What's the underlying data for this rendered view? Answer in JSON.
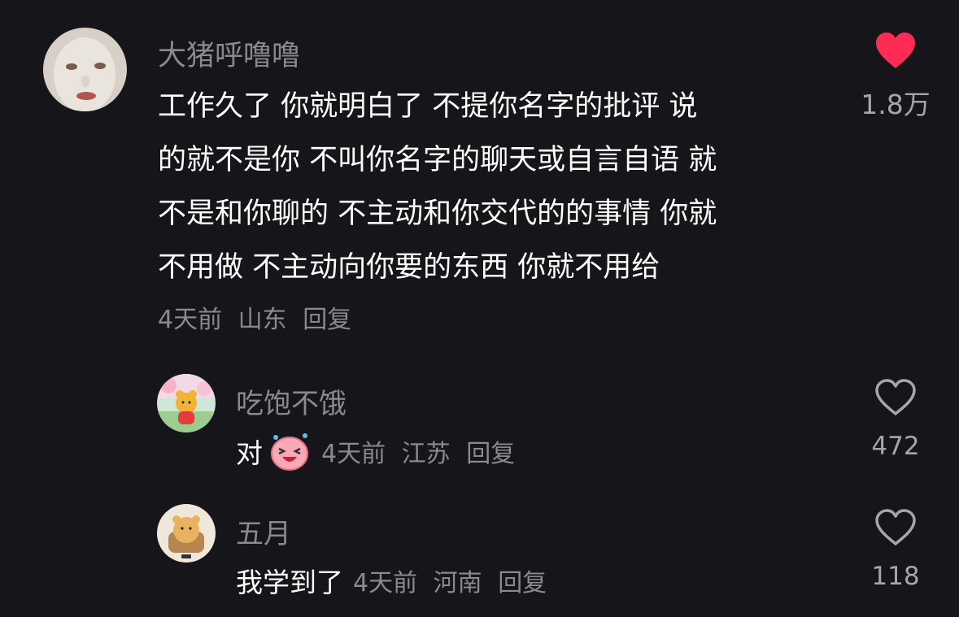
{
  "comments": [
    {
      "username": "大猪呼噜噜",
      "content_lines": [
        "工作久了 你就明白了 不提你名字的批评 说",
        "的就不是你 不叫你名字的聊天或自言自语 就",
        "不是和你聊的 不主动和你交代的的事情 你就",
        "不用做 不主动向你要的东西 你就不用给"
      ],
      "time": "4天前",
      "location": "山东",
      "reply_label": "回复",
      "likes": "1.8万",
      "liked": true,
      "like_icon": "heart-filled-icon",
      "like_color": "#fe2c55"
    }
  ],
  "replies": [
    {
      "username": "吃饱不饿",
      "text": "对",
      "sticker": "laughing-sticker-icon",
      "time": "4天前",
      "location": "江苏",
      "reply_label": "回复",
      "likes": "472",
      "liked": false,
      "like_icon": "heart-outline-icon"
    },
    {
      "username": "五月",
      "text": "我学到了",
      "time": "4天前",
      "location": "河南",
      "reply_label": "回复",
      "likes": "118",
      "liked": false,
      "like_icon": "heart-outline-icon"
    }
  ],
  "colors": {
    "background": "#16161a",
    "secondary_text": "#8a8a8e",
    "like_active": "#fe2c55"
  }
}
